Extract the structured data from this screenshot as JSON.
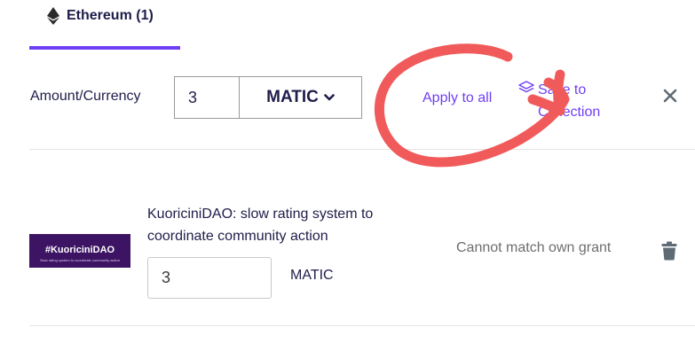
{
  "tab": {
    "label": "Ethereum (1)",
    "icon": "ethereum-icon"
  },
  "amount": {
    "label": "Amount/Currency",
    "value": "3",
    "currency": "MATIC",
    "apply_all": "Apply to all",
    "save_to_collection_line1": "Save to",
    "save_to_collection_line2": "Collection"
  },
  "grant": {
    "thumb_title": "#KuoriciniDAO",
    "thumb_subtitle": "Slow rating system to coordinate community action",
    "title": "KuoriciniDAO: slow rating system to coordinate community action",
    "amount": "3",
    "currency": "MATIC",
    "status": "Cannot match own grant"
  },
  "colors": {
    "accent": "#6f3ff5",
    "annotation": "#f15a5a",
    "text": "#1f1d4a"
  }
}
